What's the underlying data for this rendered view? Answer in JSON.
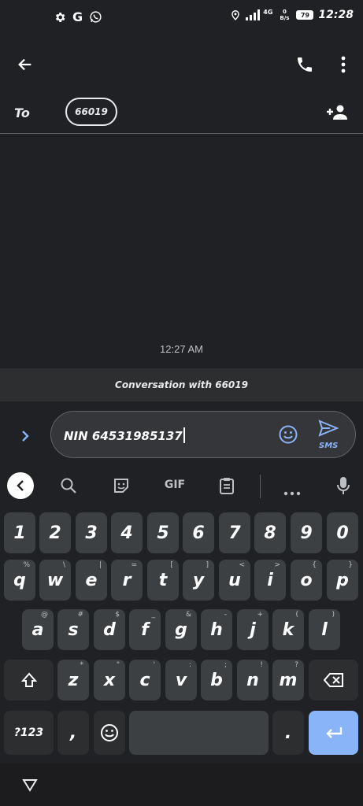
{
  "status_bar": {
    "time": "12:28",
    "battery": "79",
    "network": "4G",
    "data_rate": "0 B/s",
    "left_icons": [
      "gear-icon",
      "google-icon",
      "whatsapp-icon"
    ],
    "right_icons": [
      "location-icon",
      "signal-icon",
      "battery-icon"
    ]
  },
  "app_bar": {
    "back_icon": "arrow-back-icon",
    "call_icon": "phone-icon",
    "menu_icon": "more-vert-icon"
  },
  "recipient": {
    "to_label": "To",
    "chip": "66019",
    "add_icon": "add-person-icon"
  },
  "conversation": {
    "timestamp": "12:27 AM",
    "banner": "Conversation with 66019"
  },
  "compose": {
    "text": "NIN 64531985137",
    "send_label": "SMS",
    "emoji_icon": "emoji-icon",
    "send_icon": "send-icon",
    "expand_icon": "chevron-right-icon"
  },
  "keyboard": {
    "toolbar": {
      "items": [
        "back-icon",
        "search-icon",
        "sticker-icon",
        "GIF",
        "clipboard-icon",
        "more-icon",
        "mic-icon"
      ],
      "gif_label": "GIF"
    },
    "rows": [
      [
        "1",
        "2",
        "3",
        "4",
        "5",
        "6",
        "7",
        "8",
        "9",
        "0"
      ],
      [
        "q",
        "w",
        "e",
        "r",
        "t",
        "y",
        "u",
        "i",
        "o",
        "p"
      ],
      [
        "a",
        "s",
        "d",
        "f",
        "g",
        "h",
        "j",
        "k",
        "l"
      ],
      [
        "z",
        "x",
        "c",
        "v",
        "b",
        "n",
        "m"
      ]
    ],
    "hints": {
      "row2": [
        "%",
        "\\",
        "|",
        "=",
        "[",
        "]",
        "<",
        ">",
        "{",
        "}"
      ],
      "row3": [
        "@",
        "#",
        "$",
        "_",
        "&",
        "-",
        "+",
        "(",
        ")"
      ],
      "row4": [
        "*",
        "\"",
        "'",
        ":",
        ";",
        "!",
        "?"
      ]
    },
    "symbols_label": "?123",
    "comma_label": ",",
    "period_label": ".",
    "accent_color": "#8ab4f8"
  },
  "nav_bar": {
    "back_icon": "triangle-back-icon"
  }
}
